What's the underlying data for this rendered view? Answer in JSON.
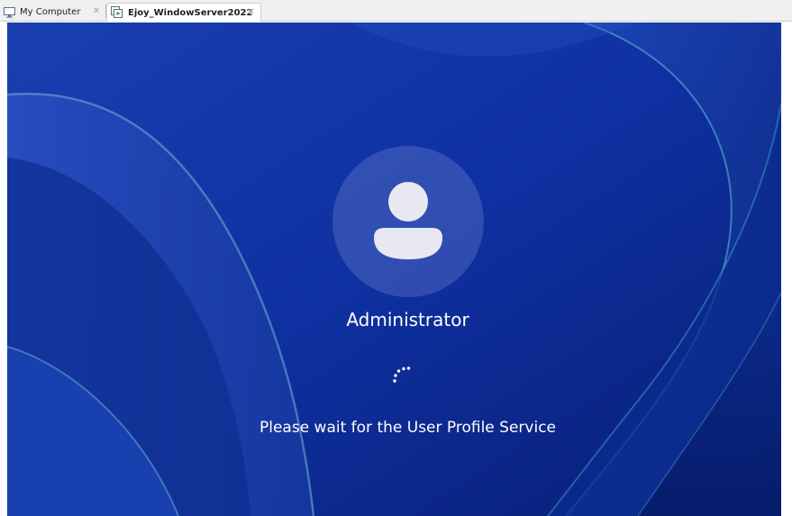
{
  "tabs": [
    {
      "label": "My Computer",
      "icon": "monitor-icon",
      "active": false
    },
    {
      "label": "Ejoy_WindowServer2022",
      "icon": "vm-running-icon",
      "active": true
    }
  ],
  "vm_screen": {
    "username": "Administrator",
    "status_text": "Please wait for the User Profile Service",
    "avatar_icon": "user-icon",
    "spinner_icon": "loading-spinner-icon"
  },
  "colors": {
    "background_blue": "#0c2f9a",
    "text": "#ffffff",
    "tab_bar": "#f0f0f0"
  }
}
